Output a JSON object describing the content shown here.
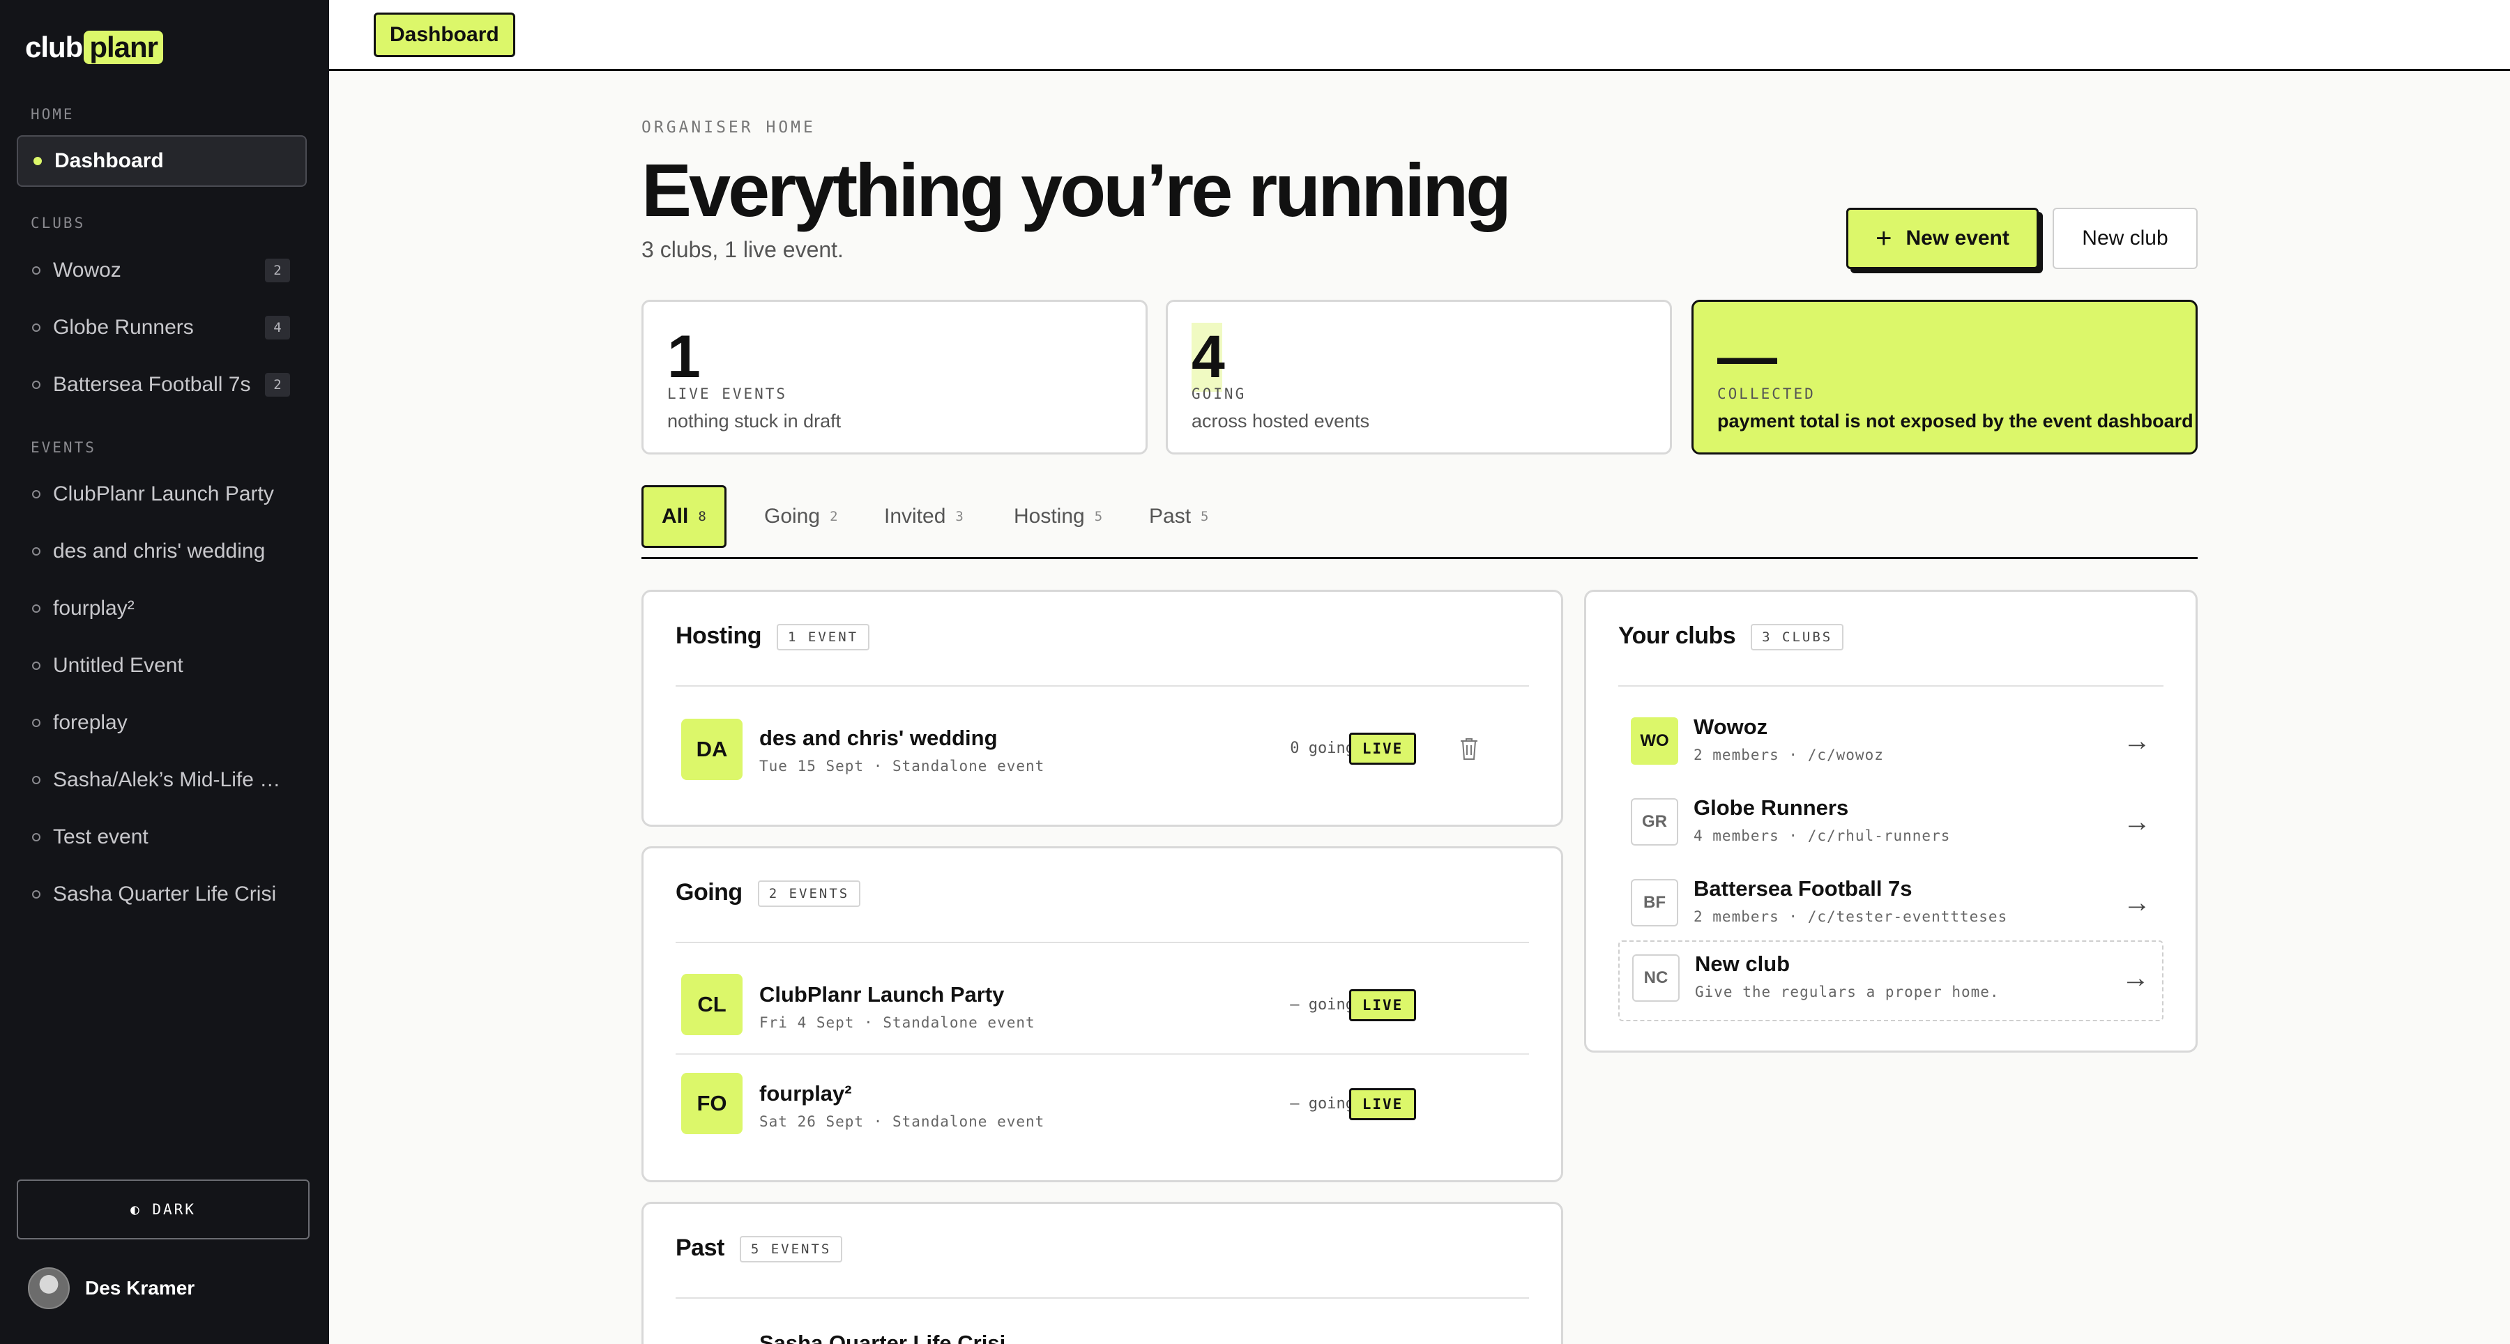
{
  "brand": {
    "part1": "club",
    "part2": "planr"
  },
  "sidebar": {
    "home_label": "HOME",
    "dashboard": "Dashboard",
    "clubs_label": "CLUBS",
    "clubs": [
      {
        "label": "Wowoz",
        "count": "2"
      },
      {
        "label": "Globe Runners",
        "count": "4"
      },
      {
        "label": "Battersea Football 7s",
        "count": "2"
      }
    ],
    "events_label": "EVENTS",
    "events": [
      "ClubPlanr Launch Party",
      "des and chris' wedding",
      "fourplay²",
      "Untitled Event",
      "foreplay",
      "Sasha/Alek’s Mid-Life C...",
      "Test event",
      "Sasha Quarter Life Crisi"
    ],
    "theme_button": "◐ DARK",
    "user_name": "Des Kramer"
  },
  "topbar": {
    "breadcrumb": "Dashboard"
  },
  "header": {
    "eyebrow": "ORGANISER HOME",
    "title": "Everything you’re running",
    "subtitle": "3 clubs, 1 live event.",
    "new_event": "New event",
    "new_club": "New club"
  },
  "stats": [
    {
      "value": "1",
      "label": "LIVE EVENTS",
      "desc": "nothing stuck in draft"
    },
    {
      "value": "4",
      "label": "GOING",
      "desc": "across hosted events"
    },
    {
      "value": "—",
      "label": "COLLECTED",
      "desc": "payment total is not exposed by the event dashboard"
    }
  ],
  "tabs": [
    {
      "label": "All",
      "count": "8"
    },
    {
      "label": "Going",
      "count": "2"
    },
    {
      "label": "Invited",
      "count": "3"
    },
    {
      "label": "Hosting",
      "count": "5"
    },
    {
      "label": "Past",
      "count": "5"
    }
  ],
  "hosting": {
    "title": "Hosting",
    "badge": "1 EVENT",
    "rows": [
      {
        "initials": "DA",
        "name": "des and chris' wedding",
        "meta": "Tue 15 Sept · Standalone event",
        "going": "0 going",
        "status": "LIVE"
      }
    ]
  },
  "going": {
    "title": "Going",
    "badge": "2 EVENTS",
    "rows": [
      {
        "initials": "CL",
        "name": "ClubPlanr Launch Party",
        "meta": "Fri 4 Sept · Standalone event",
        "going": "— going",
        "status": "LIVE"
      },
      {
        "initials": "FO",
        "name": "fourplay²",
        "meta": "Sat 26 Sept · Standalone event",
        "going": "— going",
        "status": "LIVE"
      }
    ]
  },
  "past": {
    "title": "Past",
    "badge": "5 EVENTS",
    "first_row_name": "Sasha Quarter Life Crisi"
  },
  "your_clubs": {
    "title": "Your clubs",
    "badge": "3 CLUBS",
    "clubs": [
      {
        "initials": "WO",
        "name": "Wowoz",
        "meta": "2 members · /c/wowoz"
      },
      {
        "initials": "GR",
        "name": "Globe Runners",
        "meta": "4 members · /c/rhul-runners"
      },
      {
        "initials": "BF",
        "name": "Battersea Football 7s",
        "meta": "2 members · /c/tester-eventtteses"
      },
      {
        "initials": "NC",
        "name": "New club",
        "meta": "Give the regulars a proper home."
      }
    ],
    "arrow": "→"
  },
  "colors": {
    "accent": "#dcf76a",
    "sidebar_bg": "#131418",
    "ink": "#111111"
  }
}
